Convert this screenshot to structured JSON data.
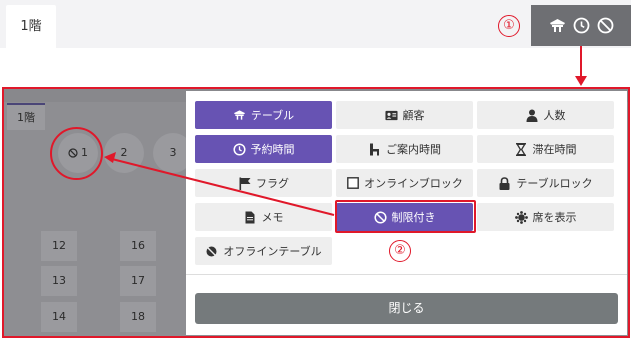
{
  "header": {
    "floor_tab": "1階"
  },
  "callouts": {
    "one": "①",
    "two": "②"
  },
  "floor_plan": {
    "mini_tab": "1階",
    "round_tables": [
      "1",
      "2",
      "3"
    ],
    "square_tables": [
      "12",
      "16",
      "13",
      "17",
      "14",
      "18"
    ]
  },
  "panel": {
    "options": [
      {
        "label": "テーブル",
        "icon": "table-icon",
        "selected": true
      },
      {
        "label": "顧客",
        "icon": "id-card-icon",
        "selected": false
      },
      {
        "label": "人数",
        "icon": "person-icon",
        "selected": false
      },
      {
        "label": "予約時間",
        "icon": "clock-icon",
        "selected": true
      },
      {
        "label": "ご案内時間",
        "icon": "chair-icon",
        "selected": false
      },
      {
        "label": "滞在時間",
        "icon": "hourglass-icon",
        "selected": false
      },
      {
        "label": "フラグ",
        "icon": "flag-icon",
        "selected": false
      },
      {
        "label": "オンラインブロック",
        "icon": "checkbox-icon",
        "selected": false
      },
      {
        "label": "テーブルロック",
        "icon": "lock-icon",
        "selected": false
      },
      {
        "label": "メモ",
        "icon": "memo-icon",
        "selected": false
      },
      {
        "label": "制限付き",
        "icon": "no-entry-icon",
        "selected": true
      },
      {
        "label": "席を表示",
        "icon": "seat-icon",
        "selected": false
      },
      {
        "label": "オフラインテーブル",
        "icon": "offline-icon",
        "selected": false
      }
    ],
    "close_label": "閉じる"
  },
  "colors": {
    "accent": "#6753b3",
    "callout": "#e0182a",
    "toolbar": "#6e6f73",
    "close_button": "#757a7c"
  }
}
